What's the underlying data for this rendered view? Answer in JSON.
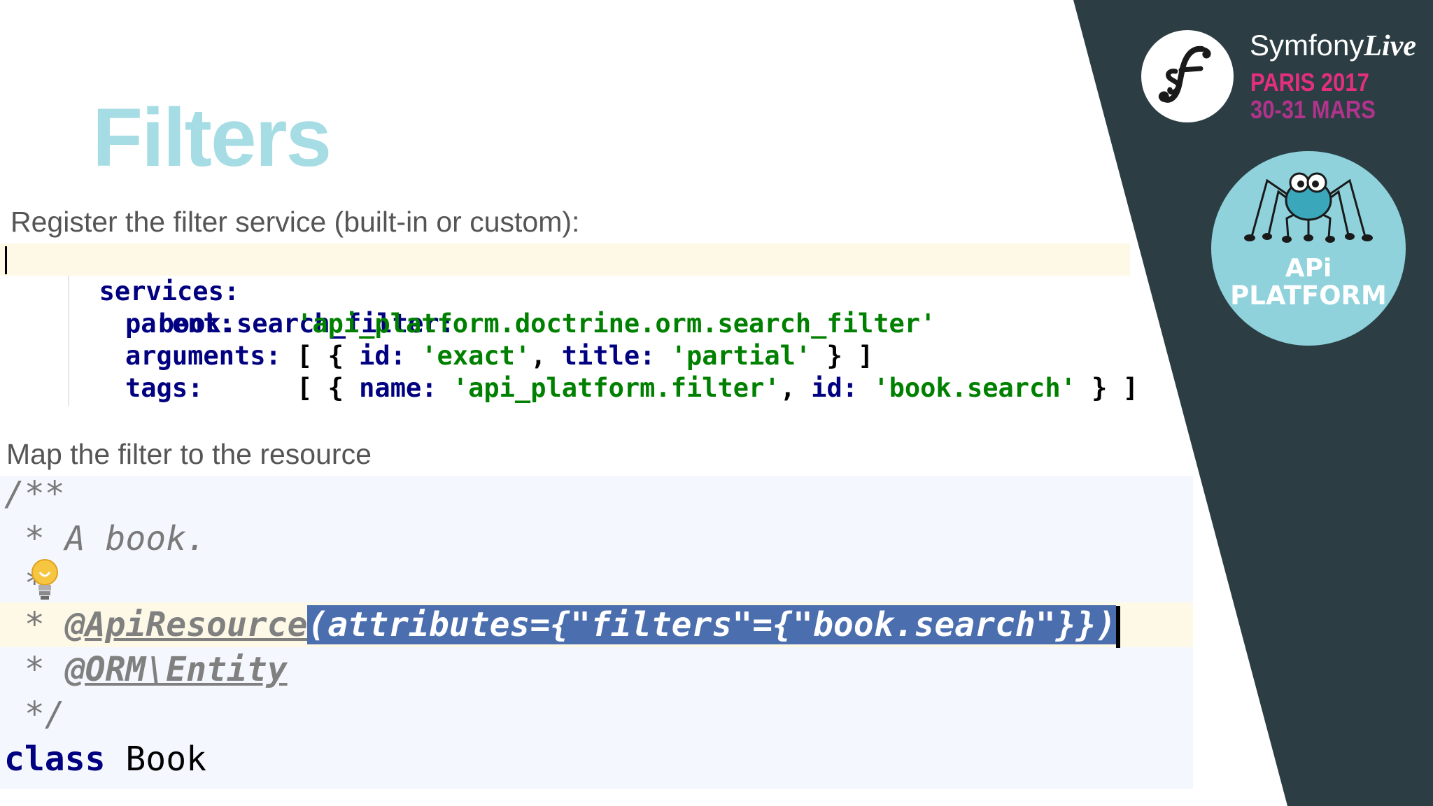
{
  "slide": {
    "title": "Filters",
    "caption_register": "Register the filter service (built-in or custom):",
    "caption_map": "Map the filter to the resource"
  },
  "yaml_code": {
    "l1": {
      "key": "services:"
    },
    "l2": {
      "key": "book.search_filter:"
    },
    "l3": {
      "key": "parent:",
      "pad": "    ",
      "value": "'api_platform.doctrine.orm.search_filter'"
    },
    "l4": {
      "key": "arguments:",
      "p1": " [ { ",
      "k1": "id:",
      "p2": " ",
      "v1": "'exact'",
      "p3": ", ",
      "k2": "title:",
      "p4": " ",
      "v2": "'partial'",
      "p5": " } ]"
    },
    "l5": {
      "key": "tags:",
      "p1": "      [ { ",
      "k1": "name:",
      "p2": " ",
      "v1": "'api_platform.filter'",
      "p3": ", ",
      "k2": "id:",
      "p4": " ",
      "v2": "'book.search'",
      "p5": " } ]"
    }
  },
  "php_code": {
    "l1": "/**",
    "l2": " * A book.",
    "l3": " *",
    "l4_prefix": " * ",
    "l4_tag": "@ApiResource",
    "l4_selected": "(attributes={\"filters\"={\"book.search\"}})",
    "l5_prefix": " * ",
    "l5_tag": "@ORM\\Entity",
    "l6": " */",
    "l7_keyword": "class",
    "l7_name": " Book"
  },
  "branding": {
    "event_name": "Symfony",
    "event_name_live": "Live",
    "event_city": "PARIS 2017",
    "event_dates": "30-31 MARS",
    "api_line1": "APi",
    "api_line2": "PLATFORM",
    "colors": {
      "panel": "#2c3e44",
      "title": "#a6dce3",
      "api_circle": "#8fd2dc",
      "pink": "#e42f7e",
      "purple": "#b1338c"
    }
  }
}
